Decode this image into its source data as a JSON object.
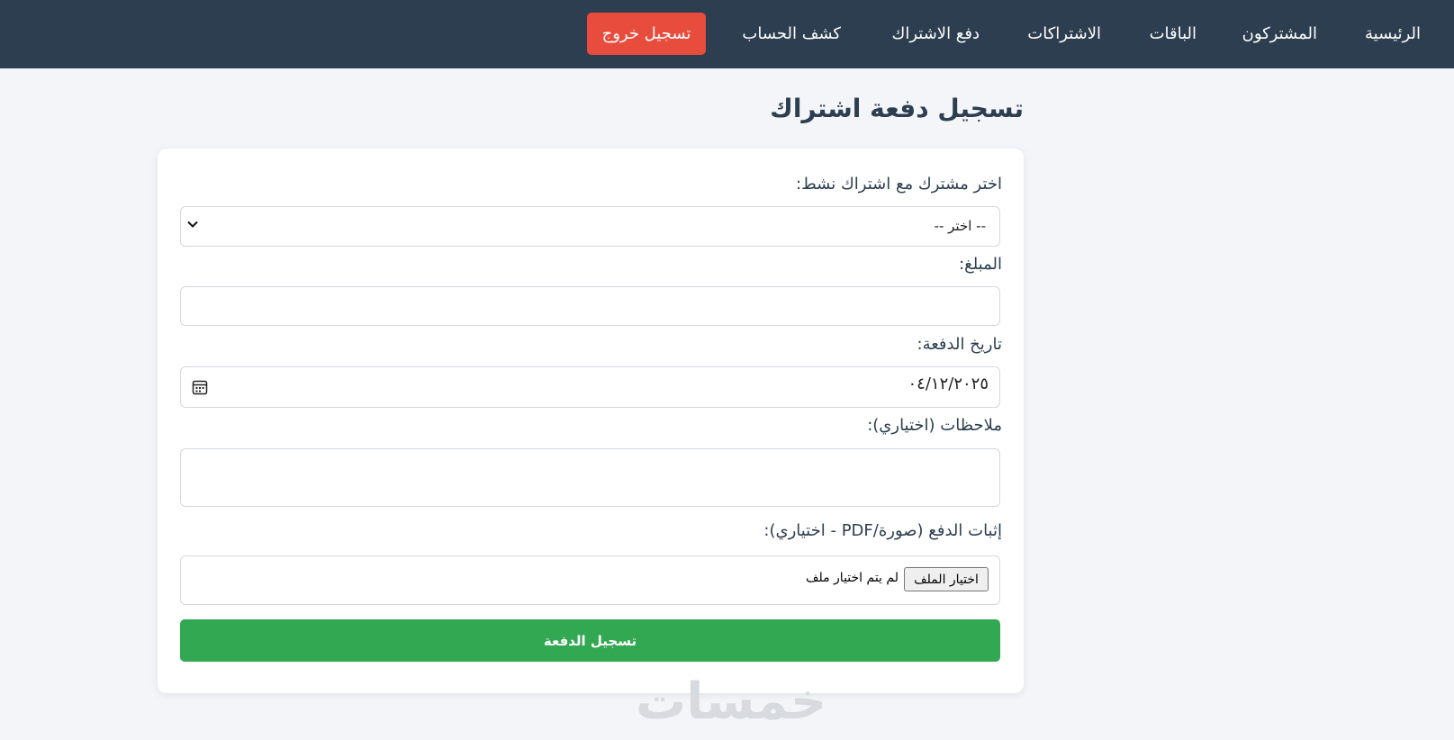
{
  "nav": {
    "home": "الرئيسية",
    "subscribers": "المشتركون",
    "packages": "الباقات",
    "subscriptions": "الاشتراكات",
    "pay_subscription": "دفع الاشتراك",
    "account_statement": "كشف الحساب",
    "logout": "تسجيل خروج"
  },
  "page": {
    "title": "تسجيل دفعة اشتراك"
  },
  "form": {
    "subscriber_label": "اختر مشترك مع اشتراك نشط:",
    "subscriber_selected": "-- اختر --",
    "amount_label": "المبلغ:",
    "amount_value": "",
    "date_label": "تاريخ الدفعة:",
    "date_value": "٠٤/١٢/٢٠٢٥",
    "notes_label": "ملاحظات (اختياري):",
    "notes_value": "",
    "proof_label": "إثبات الدفع (صورة/PDF - اختياري):",
    "file_button": "اختيار الملف",
    "file_status": "لم يتم اختيار ملف",
    "submit": "تسجيل الدفعة"
  },
  "watermark": "خمسات",
  "colors": {
    "nav_bg": "#2c3e50",
    "logout_bg": "#e74c3c",
    "submit_bg": "#32a852",
    "page_bg": "#f3f5f8"
  },
  "icons": [
    "chevron-down-icon",
    "calendar-icon",
    "resize-grip-icon"
  ]
}
